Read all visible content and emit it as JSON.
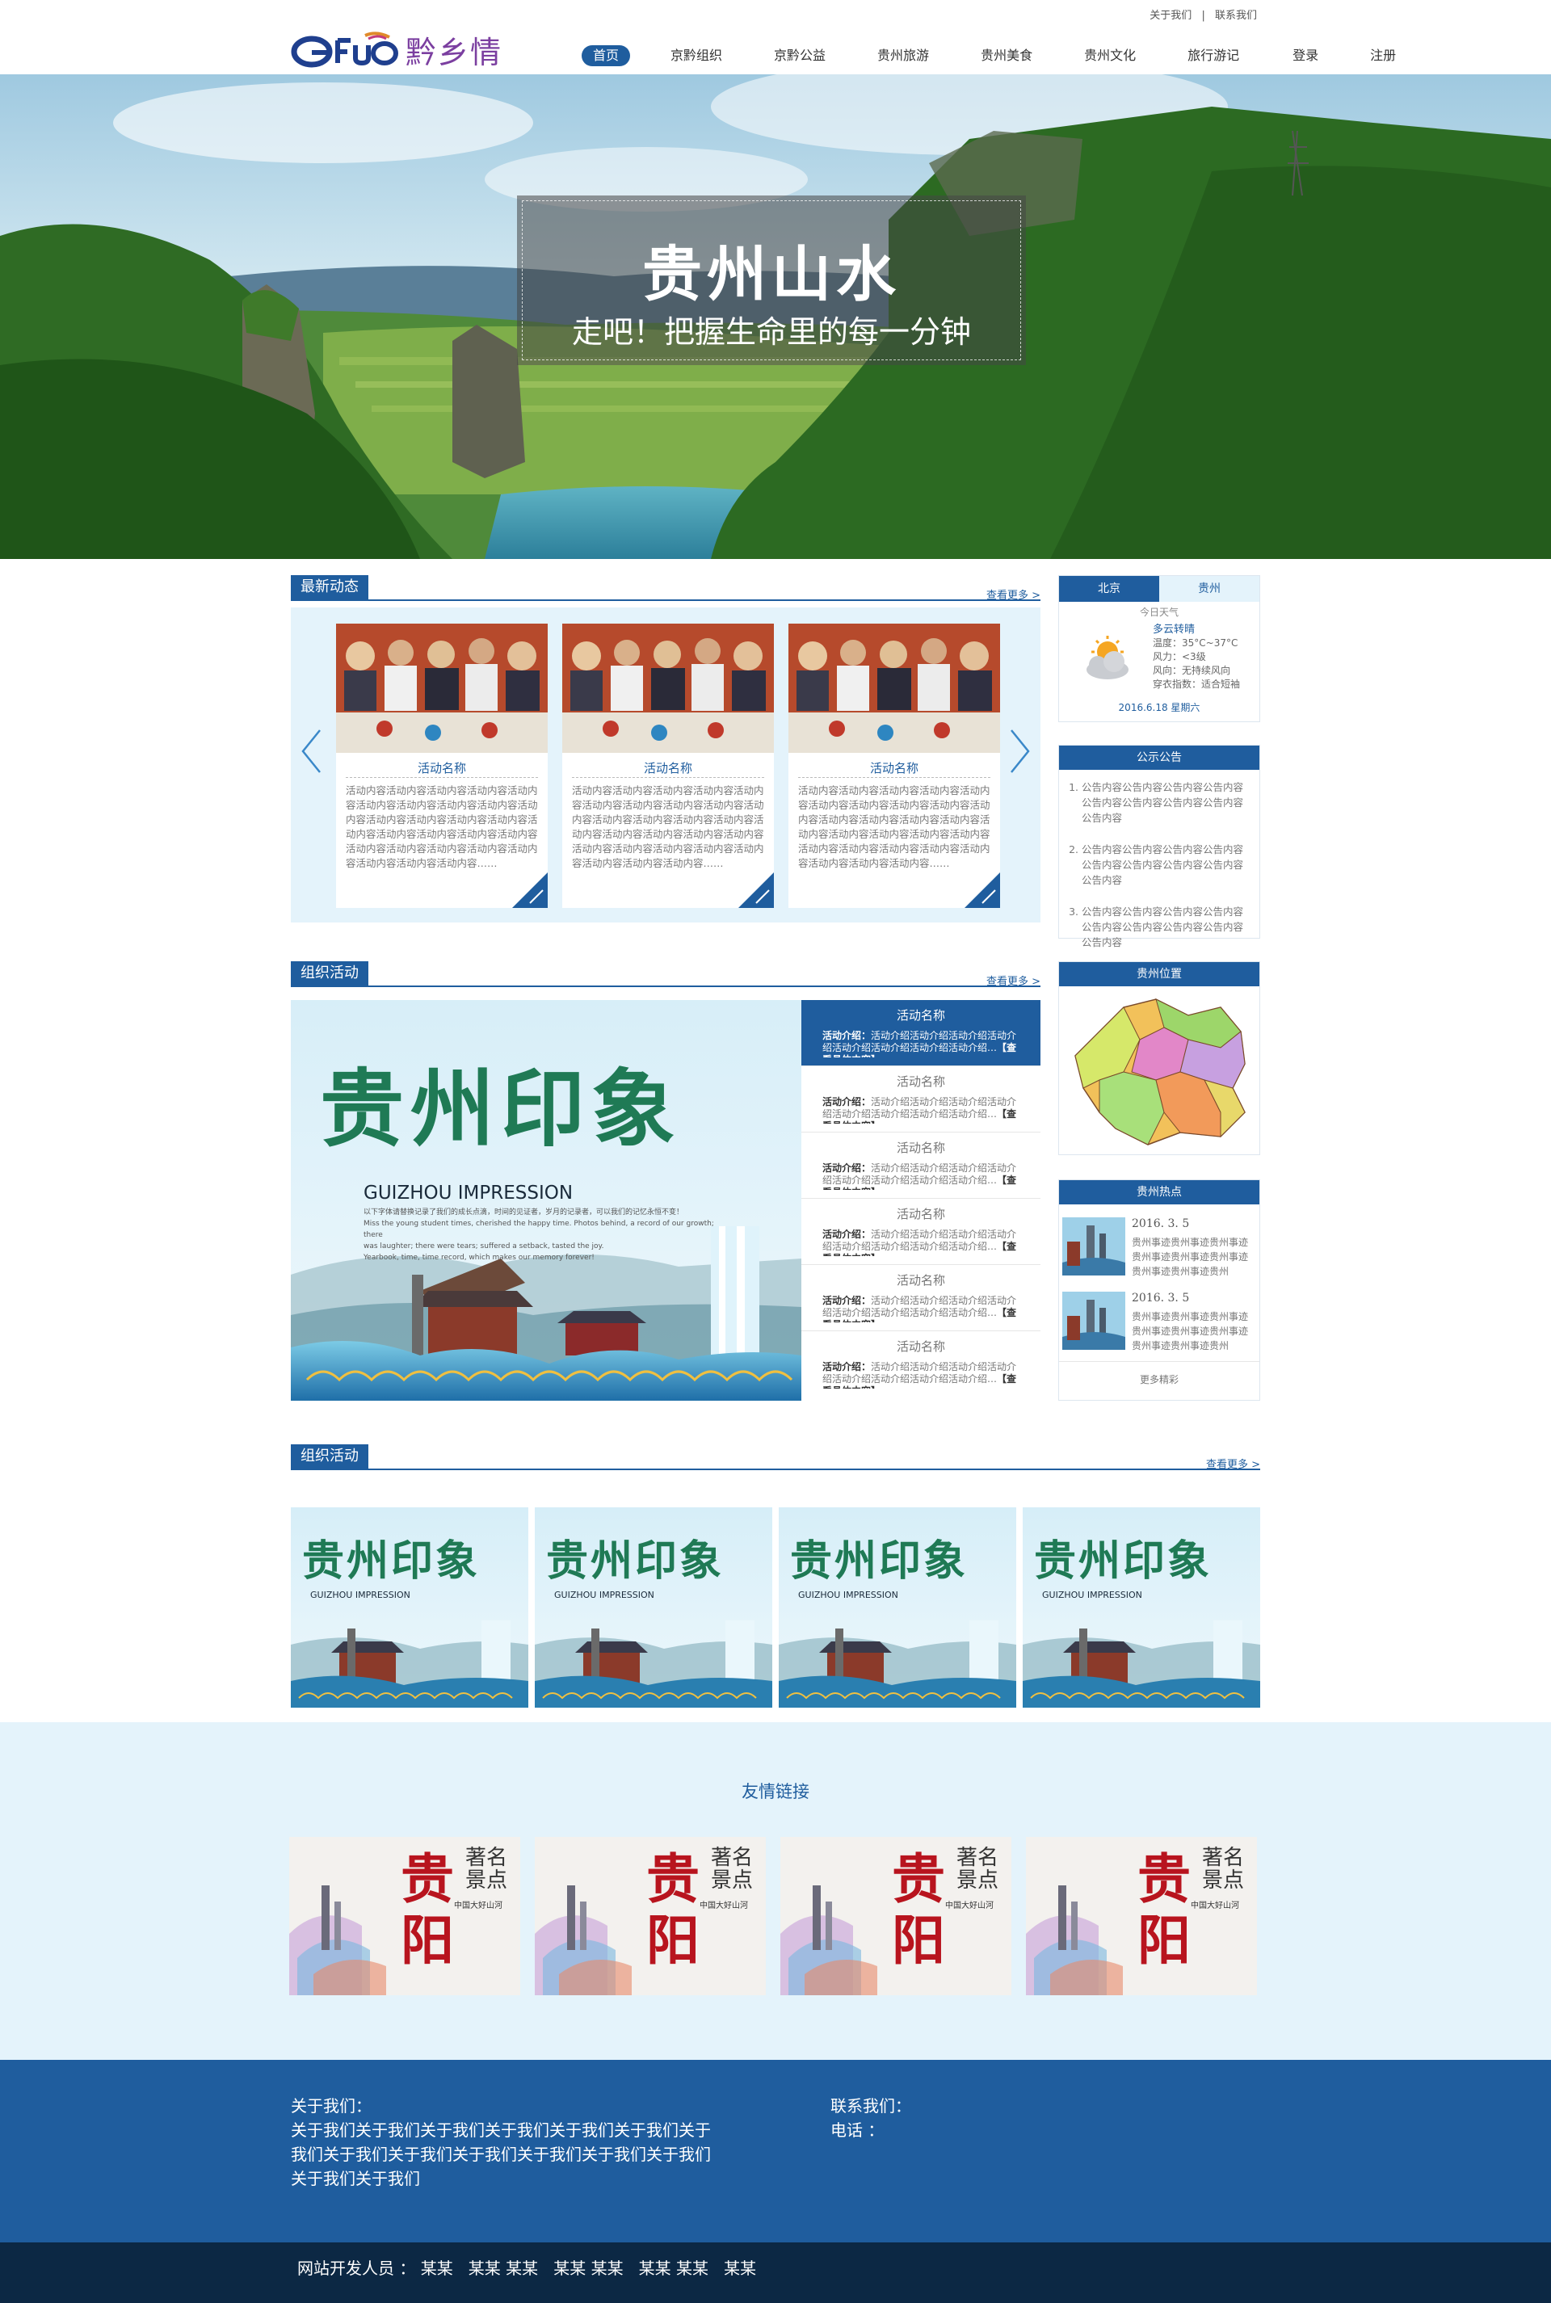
{
  "header": {
    "top_links": [
      "关于我们",
      "|",
      "联系我们"
    ],
    "logo_text": "黔乡情",
    "nav": [
      "首页",
      "京黔组织",
      "京黔公益",
      "贵州旅游",
      "贵州美食",
      "贵州文化",
      "旅行游记",
      "登录",
      "注册"
    ],
    "nav_active": 0
  },
  "hero": {
    "title": "贵州山水",
    "subtitle": "走吧！把握生命里的每一分钟"
  },
  "news": {
    "section_title": "最新动态",
    "more": "查看更多 >",
    "cards": [
      {
        "title": "活动名称",
        "text": "活动内容活动内容活动内容活动内容活动内容活动内容活动内容活动内容活动内容活动内容活动内容活动内容活动内容活动内容活动内容活动内容活动内容活动内容活动内容活动内容活动内容活动内容活动内容活动内容活动内容活动内容活动内容……"
      },
      {
        "title": "活动名称",
        "text": "活动内容活动内容活动内容活动内容活动内容活动内容活动内容活动内容活动内容活动内容活动内容活动内容活动内容活动内容活动内容活动内容活动内容活动内容活动内容活动内容活动内容活动内容活动内容活动内容活动内容活动内容活动内容……"
      },
      {
        "title": "活动名称",
        "text": "活动内容活动内容活动内容活动内容活动内容活动内容活动内容活动内容活动内容活动内容活动内容活动内容活动内容活动内容活动内容活动内容活动内容活动内容活动内容活动内容活动内容活动内容活动内容活动内容活动内容活动内容活动内容……"
      }
    ]
  },
  "weather": {
    "tabs": [
      "北京",
      "贵州"
    ],
    "active_tab": 0,
    "label": "今日天气",
    "condition": "多云转晴",
    "temp": "温度：35°C~37°C",
    "wind": "风力：<3级",
    "wind_dir": "风向：无持续风向",
    "dress": "穿衣指数：适合短袖",
    "date": "2016.6.18 星期六"
  },
  "notice": {
    "title": "公示公告",
    "items": [
      "公告内容公告内容公告内容公告内容公告内容公告内容公告内容公告内容公告内容",
      "公告内容公告内容公告内容公告内容公告内容公告内容公告内容公告内容公告内容",
      "公告内容公告内容公告内容公告内容公告内容公告内容公告内容公告内容公告内容"
    ]
  },
  "org": {
    "section_title": "组织活动",
    "more": "查看更多 >",
    "poster_title": "贵州印象",
    "poster_en": "GUIZHOU IMPRESSION",
    "poster_cn_line": "以下字体请替换记录了我们的成长点滴，时间的见证者，岁月的记录者，可以我们的记忆永恒不变！",
    "poster_en_lines": [
      "Miss the young student times, cherished the happy time. Photos behind, a record of our growth; there",
      "was laughter; there were tears; suffered a setback, tasted the joy.",
      "Yearbook, time, time record, which makes our memory forever!"
    ],
    "items": [
      {
        "title": "活动名称",
        "label": "活动介绍：",
        "text": "活动介绍活动介绍活动介绍活动介绍活动介绍活动介绍活动介绍活动介绍…",
        "link": "【查看具体内容】"
      },
      {
        "title": "活动名称",
        "label": "活动介绍：",
        "text": "活动介绍活动介绍活动介绍活动介绍活动介绍活动介绍活动介绍活动介绍…",
        "link": "【查看具体内容】"
      },
      {
        "title": "活动名称",
        "label": "活动介绍：",
        "text": "活动介绍活动介绍活动介绍活动介绍活动介绍活动介绍活动介绍活动介绍…",
        "link": "【查看具体内容】"
      },
      {
        "title": "活动名称",
        "label": "活动介绍：",
        "text": "活动介绍活动介绍活动介绍活动介绍活动介绍活动介绍活动介绍活动介绍…",
        "link": "【查看具体内容】"
      },
      {
        "title": "活动名称",
        "label": "活动介绍：",
        "text": "活动介绍活动介绍活动介绍活动介绍活动介绍活动介绍活动介绍活动介绍…",
        "link": "【查看具体内容】"
      },
      {
        "title": "活动名称",
        "label": "活动介绍：",
        "text": "活动介绍活动介绍活动介绍活动介绍活动介绍活动介绍活动介绍活动介绍…",
        "link": "【查看具体内容】"
      }
    ],
    "active_item": 0
  },
  "location": {
    "title": "贵州位置"
  },
  "hot": {
    "title": "贵州热点",
    "items": [
      {
        "date": "2016. 3. 5",
        "text": "贵州事迹贵州事迹贵州事迹贵州事迹贵州事迹贵州事迹贵州事迹贵州事迹贵州"
      },
      {
        "date": "2016. 3. 5",
        "text": "贵州事迹贵州事迹贵州事迹贵州事迹贵州事迹贵州事迹贵州事迹贵州事迹贵州"
      }
    ],
    "more": "更多精彩"
  },
  "org2": {
    "section_title": "组织活动",
    "more": "查看更多 >",
    "tile_title": "贵州印象",
    "tile_en": "GUIZHOU IMPRESSION"
  },
  "friends": {
    "title": "友情链接",
    "tile_main": "贵阳",
    "tile_side": "著名景点",
    "tile_caption": "中国大好山河"
  },
  "footer": {
    "about_label": "关于我们：",
    "about_text": "关于我们关于我们关于我们关于我们关于我们关于我们关于我们关于我们关于我们关于我们关于我们关于我们关于我们关于我们关于我们",
    "contact_label": "联系我们：",
    "phone_label": "电话 ：",
    "developers": "网站开发人员 ： 某某   某某 某某   某某 某某   某某 某某   某某"
  },
  "colors": {
    "primary": "#1f5d9e",
    "light_bg": "#e4f3fb",
    "dark_bar": "#0c2844"
  }
}
